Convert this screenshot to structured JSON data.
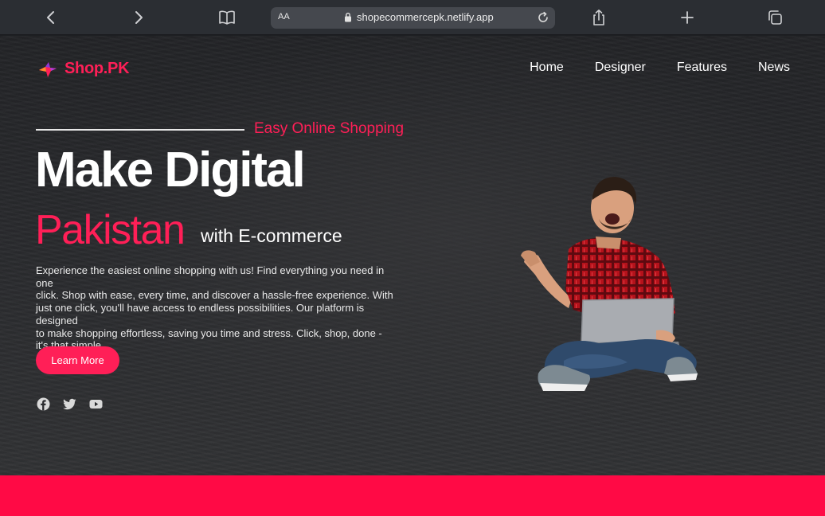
{
  "browser": {
    "text_size_label": "AA",
    "url": "shopecommercepk.netlify.app"
  },
  "brand": {
    "name": "Shop.PK",
    "accent_color": "#ff1f57"
  },
  "nav": {
    "items": [
      "Home",
      "Designer",
      "Features",
      "News"
    ]
  },
  "hero": {
    "tagline": "Easy Online Shopping",
    "headline": "Make Digital",
    "highlight": "Pakistan",
    "suffix": "with E-commerce",
    "description_lines": [
      "Experience the easiest online shopping with us! Find everything you need in one",
      "click. Shop with ease, every time, and discover a hassle-free experience. With",
      "just one click, you'll have access to endless possibilities. Our platform is designed",
      "to make shopping effortless, saving you time and stress. Click, shop, done -",
      "it's that simple"
    ],
    "cta_label": "Learn More"
  },
  "social_icons": [
    "facebook-icon",
    "twitter-icon",
    "youtube-icon"
  ]
}
